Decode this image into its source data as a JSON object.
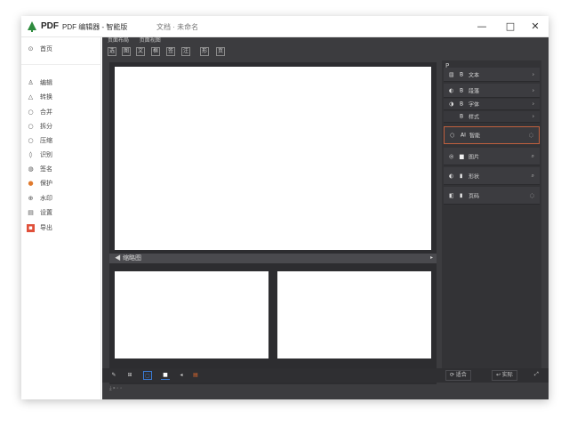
{
  "titlebar": {
    "app_name": "PDF",
    "title": "PDF 编辑器 - 智能版",
    "extra": "文档 · 未命名",
    "buttons": {
      "minimize": "—",
      "maximize": "□",
      "close": "✕"
    }
  },
  "sidebar": {
    "home": {
      "icon": "home-icon",
      "label": "首页"
    },
    "items": [
      {
        "icon": "edit-icon",
        "label": "编辑"
      },
      {
        "icon": "convert-icon",
        "label": "转换"
      },
      {
        "icon": "merge-icon",
        "label": "合并"
      },
      {
        "icon": "split-icon",
        "label": "拆分"
      },
      {
        "icon": "compress-icon",
        "label": "压缩"
      },
      {
        "icon": "ocr-icon",
        "label": "识别"
      },
      {
        "icon": "sign-icon",
        "label": "签名"
      },
      {
        "icon": "protect-icon",
        "label": "保护"
      },
      {
        "icon": "watermark-icon",
        "label": "水印"
      },
      {
        "icon": "settings-icon",
        "label": "设置"
      },
      {
        "icon": "export-icon",
        "label": "导出"
      }
    ]
  },
  "workspace": {
    "tabs": [
      "页面布局",
      "页面视图"
    ],
    "tools": [
      "选",
      "图",
      "文",
      "框",
      "签",
      "注",
      "形",
      "页"
    ],
    "mid_bar_label": "◀ 缩略图",
    "mid_bar_arrow": "▸"
  },
  "right_panel": {
    "header_icon": "P",
    "rows": [
      {
        "a": "▤",
        "b": "B",
        "label": "文本",
        "end": "›",
        "style": ""
      },
      {
        "a": "◐",
        "b": "B",
        "label": "段落",
        "end": "›",
        "style": ""
      },
      {
        "a": "◑",
        "b": "B",
        "label": "字体",
        "end": "›",
        "style": "sub"
      },
      {
        "a": "",
        "b": "B",
        "label": "样式",
        "end": "›",
        "style": "sub"
      },
      {
        "a": "○",
        "b": "AI",
        "label": "智能",
        "end": "◌",
        "style": "sel"
      },
      {
        "a": "◎",
        "b": "▆",
        "label": "图片",
        "end": "⌕",
        "style": "big"
      },
      {
        "a": "◐",
        "b": "▮",
        "label": "形状",
        "end": "⌕",
        "style": "big"
      },
      {
        "a": "◧",
        "b": "▮",
        "label": "页码",
        "end": "◌",
        "style": "big"
      }
    ]
  },
  "statusbar": {
    "left_icons": [
      "✎",
      "⊞",
      "▢",
      "■",
      "◂",
      "▤"
    ],
    "left_colors": [
      "#cfcfcf",
      "#cfcfcf",
      "#3a7bd5",
      "#ffffff",
      "#cfcfcf",
      "#e26a2c"
    ],
    "btn_one": "⟳ 适合",
    "btn_two": "↩ 实际",
    "btn_three": "⤢"
  },
  "ghost_text": "⤓ ▸ ◦ ◦"
}
